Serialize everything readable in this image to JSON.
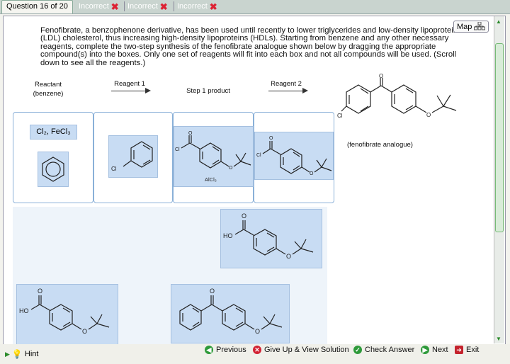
{
  "tabs": {
    "current": "Question 16 of 20",
    "prev": [
      "Incorrect",
      "Incorrect",
      "Incorrect"
    ]
  },
  "map": {
    "label": "Map"
  },
  "question": {
    "text": "Fenofibrate, a benzophenone derivative, has been used until recently to lower triglycerides and low-density lipoprotein (LDL) cholesterol, thus increasing high-density lipoproteins (HDLs). Starting from benzene and any other necessary reagents, complete the two-step synthesis of the fenofibrate analogue shown below by dragging the appropriate compound(s) into the boxes. Only one set of reagents will fit into each box and not all compounds will be used. (Scroll down to see all the reagents.)"
  },
  "scheme": {
    "reactant_label": "Reactant",
    "reactant_sub": "(benzene)",
    "reagent1_label": "Reagent 1",
    "step1_label": "Step 1 product",
    "reagent2_label": "Reagent 2",
    "product_caption": "(fenofibrate analogue)"
  },
  "boxes": {
    "reactant_text": "Cl₂, FeCl₃",
    "step1_catalyst": "AlCl₃"
  },
  "atoms": {
    "cl": "Cl",
    "o": "O",
    "ho": "HO"
  },
  "footer": {
    "hint": "Hint",
    "previous": "Previous",
    "giveup": "Give Up & View Solution",
    "check": "Check Answer",
    "next": "Next",
    "exit": "Exit"
  },
  "colors": {
    "tile": "#c8dcf3",
    "incorrect": "#d22233",
    "nav_green": "#2e9a3a"
  }
}
